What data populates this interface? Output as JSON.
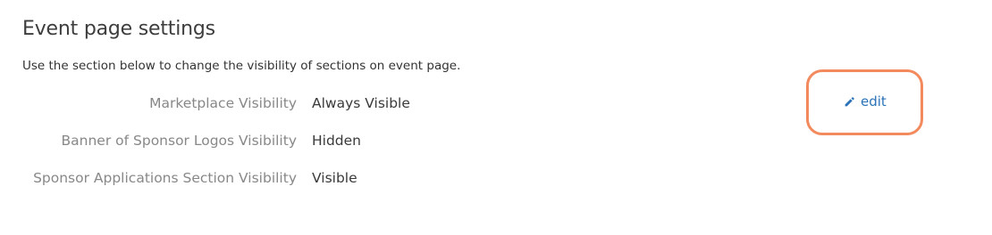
{
  "section": {
    "title": "Event page settings",
    "description": "Use the section below to change the visibility of sections on event page."
  },
  "settings": [
    {
      "label": "Marketplace Visibility",
      "value": "Always Visible"
    },
    {
      "label": "Banner of Sponsor Logos Visibility",
      "value": "Hidden"
    },
    {
      "label": "Sponsor Applications Section Visibility",
      "value": "Visible"
    }
  ],
  "actions": {
    "edit_label": "edit",
    "edit_icon": "pencil-icon"
  },
  "colors": {
    "link": "#2b72b8",
    "highlight": "#f28a5e",
    "label": "#888888",
    "value": "#3a3a3a"
  }
}
